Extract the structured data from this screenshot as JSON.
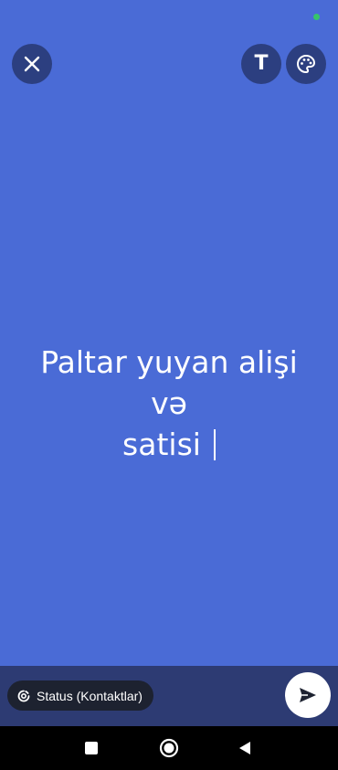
{
  "editor": {
    "status_text_line1": "Paltar yuyan alişi və",
    "status_text_line2": "satisi",
    "background_color": "#4a6bd6"
  },
  "toolbar": {
    "close_icon": "close-icon",
    "text_tool_label": "T",
    "palette_icon": "palette-icon"
  },
  "footer": {
    "audience_label": "Status (Kontaktlar)",
    "send_icon": "send-icon"
  },
  "system_nav": {
    "recents_icon": "square-icon",
    "home_icon": "circle-icon",
    "back_icon": "triangle-back-icon"
  }
}
